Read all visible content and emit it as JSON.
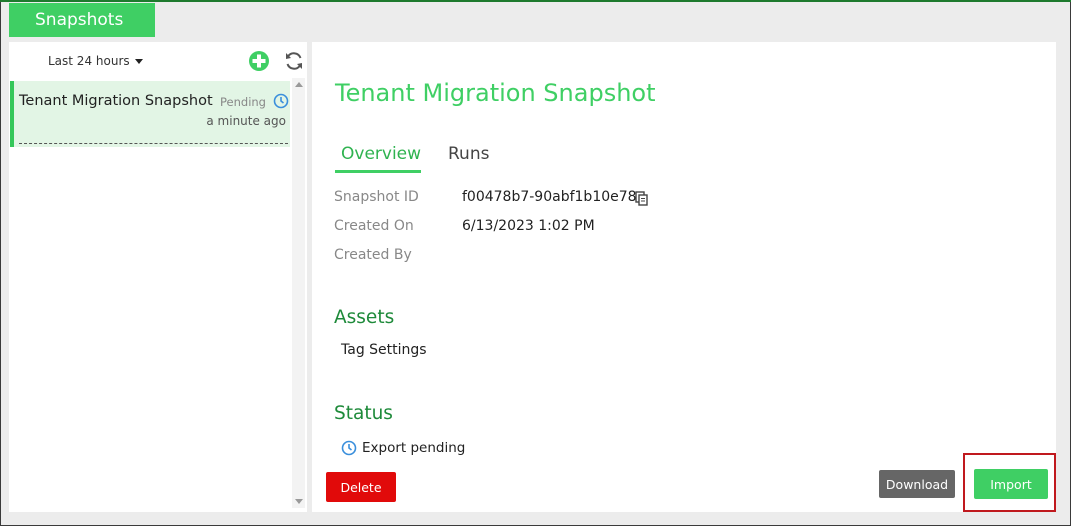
{
  "app": {
    "tab_label": "Snapshots"
  },
  "sidebar": {
    "filter_label": "Last 24 hours",
    "items": [
      {
        "title": "Tenant Migration Snapshot",
        "status": "Pending",
        "time": "a minute ago"
      }
    ]
  },
  "detail": {
    "title": "Tenant Migration Snapshot",
    "tabs": [
      {
        "label": "Overview"
      },
      {
        "label": "Runs"
      }
    ],
    "fields": [
      {
        "label": "Snapshot ID",
        "value": "f00478b7-90abf1b10e78"
      },
      {
        "label": "Created On",
        "value": "6/13/2023 1:02 PM"
      },
      {
        "label": "Created By",
        "value": ""
      }
    ],
    "assets_heading": "Assets",
    "assets": [
      "Tag Settings"
    ],
    "status_heading": "Status",
    "status_text": "Export pending"
  },
  "buttons": {
    "delete": "Delete",
    "download": "Download",
    "import": "Import"
  },
  "icons": {
    "add": "plus-circle-icon",
    "refresh": "refresh-icon",
    "clock": "clock-icon",
    "copy": "copy-icon",
    "caret": "caret-down-icon"
  },
  "colors": {
    "brand_green": "#3fcf64",
    "heading_green": "#1e8a3a",
    "danger": "#e10a0a",
    "neutral_button": "#666666",
    "highlight": "#c0191e",
    "clock_blue": "#3a8fdc"
  }
}
